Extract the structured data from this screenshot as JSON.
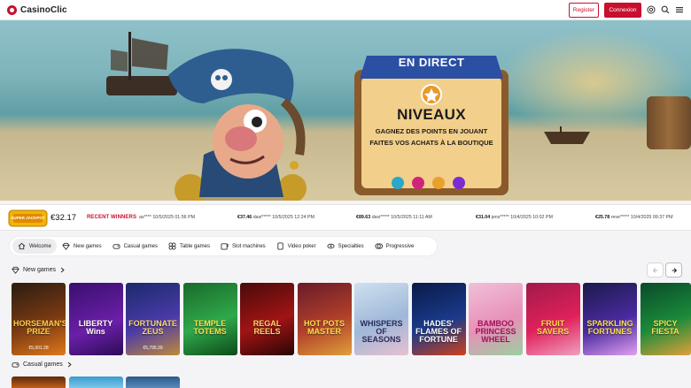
{
  "header": {
    "brand": "CasinoClic",
    "register_label": "Register",
    "connexion_label": "Connexion"
  },
  "banner": {
    "badge": "EN DIRECT",
    "title": "NIVEAUX",
    "line1": "GAGNEZ DES POINTS EN JOUANT",
    "line2": "FAITES VOS ACHATS À LA BOUTIQUE"
  },
  "jackpot": {
    "badge_text": "SUPER JACKPOT",
    "amount": "€32.17"
  },
  "recent_winners": {
    "label": "RECENT WINNERS",
    "items": [
      {
        "amount": "",
        "user": "as****",
        "date": "10/5/2025 01:56 PM"
      },
      {
        "amount": "€37.46",
        "user": "davi*****",
        "date": "10/5/2025 12:24 PM"
      },
      {
        "amount": "€89.63",
        "user": "davi*****",
        "date": "10/5/2025 11:11 AM"
      },
      {
        "amount": "€31.04",
        "user": "jens*****",
        "date": "10/4/2025 10:02 PM"
      },
      {
        "amount": "€25.78",
        "user": "reve*****",
        "date": "10/4/2025 09:37 PM"
      }
    ]
  },
  "tabs": [
    {
      "label": "Welcome",
      "icon": "home-icon"
    },
    {
      "label": "New games",
      "icon": "diamond-icon"
    },
    {
      "label": "Casual games",
      "icon": "controller-icon"
    },
    {
      "label": "Table games",
      "icon": "cards-icon"
    },
    {
      "label": "Slot machines",
      "icon": "slot-icon"
    },
    {
      "label": "Video poker",
      "icon": "poker-icon"
    },
    {
      "label": "Specialties",
      "icon": "chip-icon"
    },
    {
      "label": "Progressive",
      "icon": "coins-icon"
    }
  ],
  "sections": {
    "new_games": "New games",
    "casual_games": "Casual games"
  },
  "new_games": [
    {
      "title": "HORSEMAN'S PRIZE",
      "jackpot": "€5,001.28"
    },
    {
      "title": "LIBERTY Wins",
      "jackpot": ""
    },
    {
      "title": "FORTUNATE ZEUS",
      "jackpot": "€5,795.39"
    },
    {
      "title": "TEMPLE TOTEMS",
      "jackpot": ""
    },
    {
      "title": "REGAL REELS",
      "jackpot": ""
    },
    {
      "title": "HOT POTS MASTER",
      "jackpot": ""
    },
    {
      "title": "WHISPERS OF SEASONS",
      "jackpot": ""
    },
    {
      "title": "HADES' FLAMES OF FORTUNE",
      "jackpot": ""
    },
    {
      "title": "BAMBOO PRINCESS WHEEL",
      "jackpot": ""
    },
    {
      "title": "FRUIT SAVERS",
      "jackpot": ""
    },
    {
      "title": "SPARKLING FORTUNES",
      "jackpot": ""
    },
    {
      "title": "SPICY FIESTA",
      "jackpot": ""
    }
  ],
  "colors": {
    "brand_red": "#c8102e"
  }
}
